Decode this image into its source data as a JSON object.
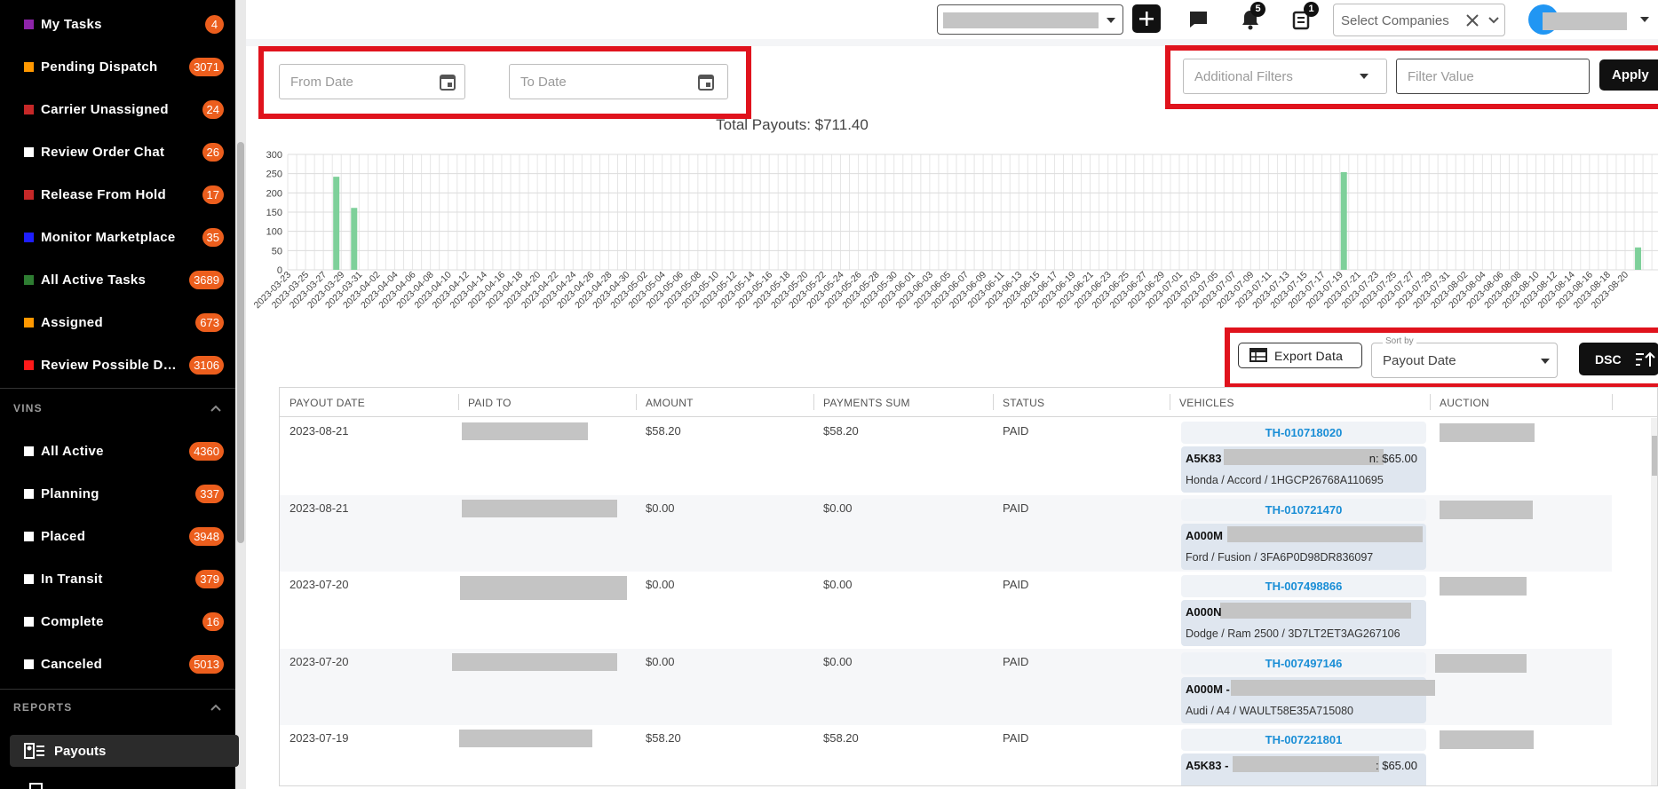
{
  "sidebar": {
    "task_items": [
      {
        "label": "My Tasks",
        "count": "4",
        "color": "#8e24aa"
      },
      {
        "label": "Pending Dispatch",
        "count": "3071",
        "color": "#ff9800"
      },
      {
        "label": "Carrier Unassigned",
        "count": "24",
        "color": "#c62828"
      },
      {
        "label": "Review Order Chat",
        "count": "26",
        "color": "#ffffff"
      },
      {
        "label": "Release From Hold",
        "count": "17",
        "color": "#c62828"
      },
      {
        "label": "Monitor Marketplace",
        "count": "35",
        "color": "#1e1eff"
      },
      {
        "label": "All Active Tasks",
        "count": "3689",
        "color": "#2e7d32"
      },
      {
        "label": "Assigned",
        "count": "673",
        "color": "#ff9800"
      },
      {
        "label": "Review Possible Duplicates",
        "count": "3106",
        "color": "#ff1a1a"
      }
    ],
    "vins_heading": "VINS",
    "vin_items": [
      {
        "label": "All Active",
        "count": "4360",
        "color": "#ffffff"
      },
      {
        "label": "Planning",
        "count": "337",
        "color": "#ffffff"
      },
      {
        "label": "Placed",
        "count": "3948",
        "color": "#ffffff"
      },
      {
        "label": "In Transit",
        "count": "379",
        "color": "#ffffff"
      },
      {
        "label": "Complete",
        "count": "16",
        "color": "#ffffff"
      },
      {
        "label": "Canceled",
        "count": "5013",
        "color": "#ffffff"
      }
    ],
    "reports_heading": "REPORTS",
    "payouts_label": "Payouts"
  },
  "topbar": {
    "notifications_count": "5",
    "tasks_count": "1",
    "companies_placeholder": "Select Companies"
  },
  "filters": {
    "from_date_placeholder": "From Date",
    "to_date_placeholder": "To Date",
    "additional_filters_placeholder": "Additional Filters",
    "filter_value_placeholder": "Filter Value",
    "apply_label": "Apply"
  },
  "chart_data": {
    "type": "bar",
    "title": "Total Payouts: $711.40",
    "ylim": [
      0,
      300
    ],
    "yticks": [
      0,
      50,
      100,
      150,
      200,
      250,
      300
    ],
    "categories": [
      "2023-03-23",
      "2023-03-25",
      "2023-03-27",
      "2023-03-29",
      "2023-03-31",
      "2023-04-02",
      "2023-04-04",
      "2023-04-06",
      "2023-04-08",
      "2023-04-10",
      "2023-04-12",
      "2023-04-14",
      "2023-04-16",
      "2023-04-18",
      "2023-04-20",
      "2023-04-22",
      "2023-04-24",
      "2023-04-26",
      "2023-04-28",
      "2023-04-30",
      "2023-05-02",
      "2023-05-04",
      "2023-05-06",
      "2023-05-08",
      "2023-05-10",
      "2023-05-12",
      "2023-05-14",
      "2023-05-16",
      "2023-05-18",
      "2023-05-20",
      "2023-05-22",
      "2023-05-24",
      "2023-05-26",
      "2023-05-28",
      "2023-05-30",
      "2023-06-01",
      "2023-06-03",
      "2023-06-05",
      "2023-06-07",
      "2023-06-09",
      "2023-06-11",
      "2023-06-13",
      "2023-06-15",
      "2023-06-17",
      "2023-06-19",
      "2023-06-21",
      "2023-06-23",
      "2023-06-25",
      "2023-06-27",
      "2023-06-29",
      "2023-07-01",
      "2023-07-03",
      "2023-07-05",
      "2023-07-07",
      "2023-07-09",
      "2023-07-11",
      "2023-07-13",
      "2023-07-15",
      "2023-07-17",
      "2023-07-19",
      "2023-07-21",
      "2023-07-23",
      "2023-07-25",
      "2023-07-27",
      "2023-07-29",
      "2023-07-31",
      "2023-08-02",
      "2023-08-04",
      "2023-08-06",
      "2023-08-08",
      "2023-08-10",
      "2023-08-12",
      "2023-08-14",
      "2023-08-16",
      "2023-08-18",
      "2023-08-20"
    ],
    "bars": [
      {
        "date": "2023-03-28",
        "value": 242
      },
      {
        "date": "2023-03-30",
        "value": 161
      },
      {
        "date": "2023-07-19",
        "value": 254
      },
      {
        "date": "2023-08-21",
        "value": 58.2
      }
    ],
    "bar_color": "#7ed09a",
    "grid": true
  },
  "toolbar": {
    "export_label": "Export Data",
    "sort_by_label": "Sort by",
    "sort_value": "Payout Date",
    "order_label": "DSC"
  },
  "table": {
    "columns": [
      "PAYOUT DATE",
      "PAID TO",
      "AMOUNT",
      "PAYMENTS SUM",
      "STATUS",
      "VEHICLES",
      "AUCTION"
    ],
    "rows": [
      {
        "date": "2023-08-21",
        "amount": "$58.20",
        "sum": "$58.20",
        "status": "PAID",
        "vehicle_id": "TH-010718020",
        "vehicle_prefix": "A5K83",
        "vehicle_amount": "n: $65.00",
        "vehicle_desc": "Honda / Accord / 1HGCP26768A110695"
      },
      {
        "date": "2023-08-21",
        "amount": "$0.00",
        "sum": "$0.00",
        "status": "PAID",
        "vehicle_id": "TH-010721470",
        "vehicle_prefix": "A000M",
        "vehicle_amount": "",
        "vehicle_desc": "Ford / Fusion / 3FA6P0D98DR836097"
      },
      {
        "date": "2023-07-20",
        "amount": "$0.00",
        "sum": "$0.00",
        "status": "PAID",
        "vehicle_id": "TH-007498866",
        "vehicle_prefix": "A000N",
        "vehicle_amount": "",
        "vehicle_desc": "Dodge / Ram 2500 / 3D7LT2ET3AG267106"
      },
      {
        "date": "2023-07-20",
        "amount": "$0.00",
        "sum": "$0.00",
        "status": "PAID",
        "vehicle_id": "TH-007497146",
        "vehicle_prefix": "A000M -",
        "vehicle_amount": "",
        "vehicle_desc": "Audi / A4 / WAULT58E35A715080"
      },
      {
        "date": "2023-07-19",
        "amount": "$58.20",
        "sum": "$58.20",
        "status": "PAID",
        "vehicle_id": "TH-007221801",
        "vehicle_prefix": "A5K83 -",
        "vehicle_amount": ": $65.00",
        "vehicle_desc": ""
      }
    ]
  }
}
